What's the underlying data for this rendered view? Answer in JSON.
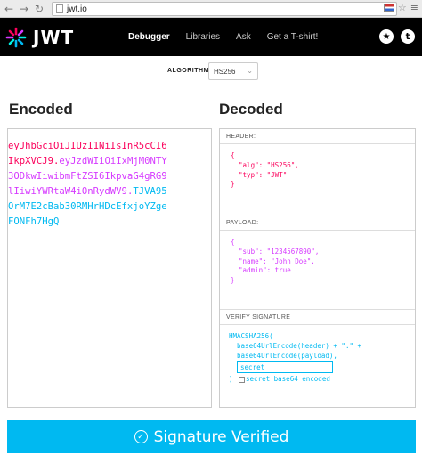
{
  "browser": {
    "url": "jwt.io",
    "back_icon": "back-arrow-icon",
    "forward_icon": "forward-arrow-icon",
    "reload_icon": "reload-icon"
  },
  "nav": {
    "logo_text": "JWT",
    "links": [
      "Debugger",
      "Libraries",
      "Ask",
      "Get a T-shirt!"
    ],
    "active": "Debugger",
    "right_icons": [
      "auth0-shield-icon",
      "twitter-icon"
    ]
  },
  "algorithm": {
    "label": "ALGORITHM",
    "selected": "HS256"
  },
  "encoded": {
    "title": "Encoded",
    "lines": [
      {
        "red": "eyJhbGciOiJIUzI1NiIsInR5cCI6",
        "purple": "",
        "cyan": ""
      },
      {
        "red": "IkpXVCJ9",
        "dot1": ".",
        "purple": "eyJzdWIiOiIxMjM0NTY",
        "cyan": ""
      },
      {
        "red": "",
        "purple": "3ODkwIiwibmFtZSI6IkpvaG4gRG9",
        "cyan": ""
      },
      {
        "red": "",
        "purple": "lIiwiYWRtaW4iOnRydWV9",
        "dot2": ".",
        "cyan": "TJVA95"
      },
      {
        "red": "",
        "purple": "",
        "cyan": "OrM7E2cBab30RMHrHDcEfxjoYZge"
      },
      {
        "red": "",
        "purple": "",
        "cyan": "FONFh7HgQ"
      }
    ]
  },
  "decoded": {
    "title": "Decoded",
    "header_label": "HEADER:",
    "header_lines": [
      "{",
      "  \"alg\": \"HS256\",",
      "  \"typ\": \"JWT\"",
      "}"
    ],
    "payload_label": "PAYLOAD:",
    "payload_lines": [
      "{",
      "  \"sub\": \"1234567890\",",
      "  \"name\": \"John Doe\",",
      "  \"admin\": true",
      "}"
    ],
    "verify_label": "VERIFY SIGNATURE",
    "verify_lines": [
      "HMACSHA256(",
      "  base64UrlEncode(header) + \".\" +",
      "  base64UrlEncode(payload),"
    ],
    "secret_value": "secret",
    "closing": ")",
    "checkbox_label": "secret base64 encoded"
  },
  "status": {
    "text": "Signature Verified",
    "icon": "check-circle-icon"
  },
  "colors": {
    "header": "#fb015b",
    "payload": "#d63aff",
    "signature": "#00b9f1"
  }
}
